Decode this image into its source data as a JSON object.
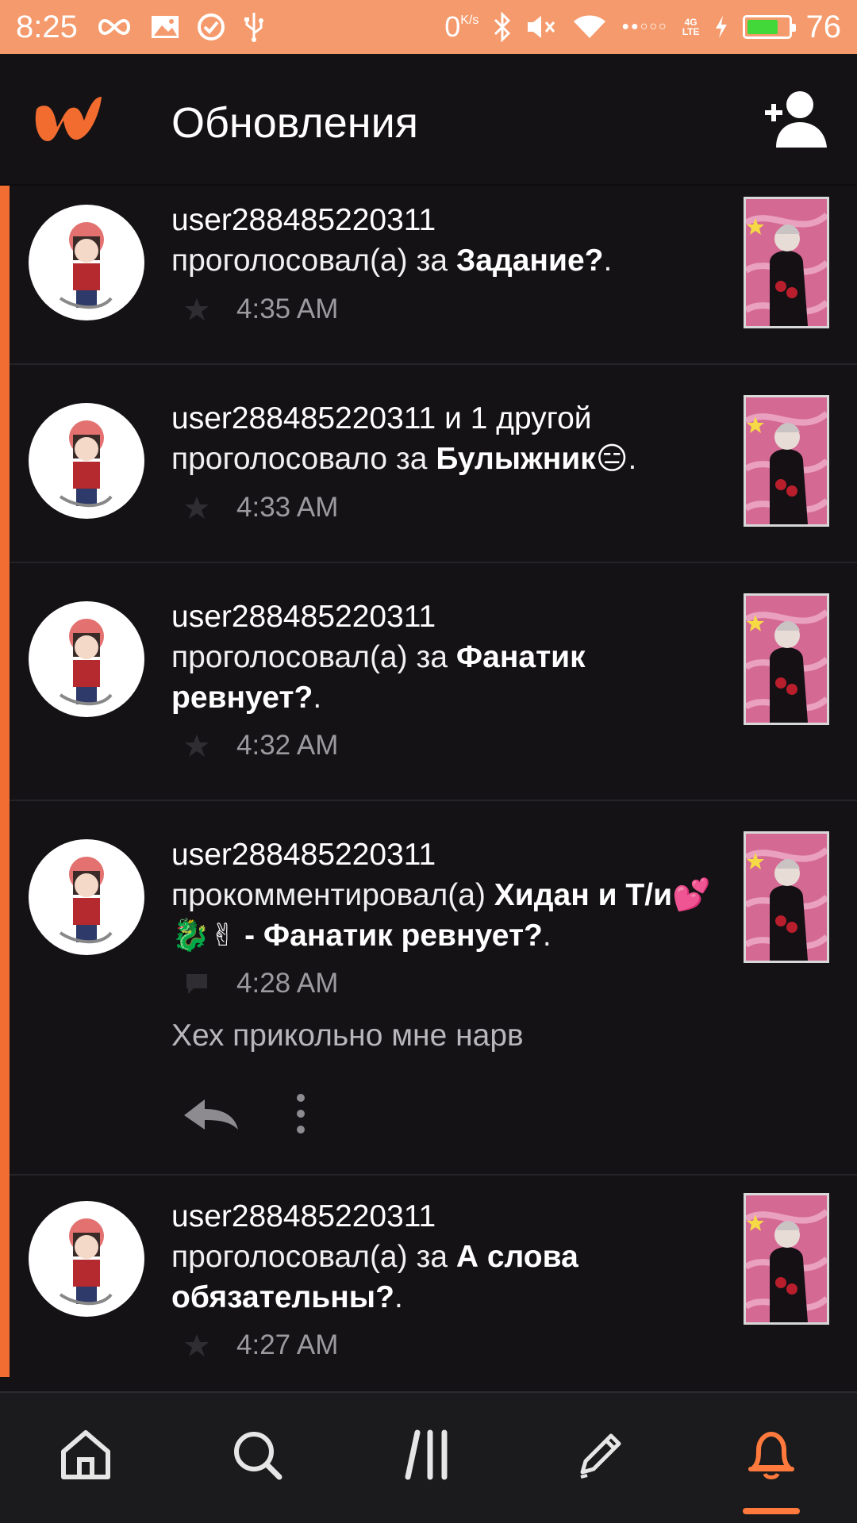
{
  "status_bar": {
    "time": "8:25",
    "net_speed": "0",
    "net_speed_unit": "K/s",
    "network_type_top": "4G",
    "network_type_bottom": "LTE",
    "battery_percent": "76",
    "battery_level": 0.76,
    "icons": [
      "infinity-icon",
      "image-icon",
      "check-circle-icon",
      "usb-icon",
      "bluetooth-icon",
      "mute-icon",
      "wifi-icon",
      "signal-icon",
      "charging-icon",
      "battery-icon"
    ]
  },
  "app_bar": {
    "title": "Обновления",
    "logo": "wattpad-logo",
    "add_user_icon": "add-user-icon",
    "accent": "#f26d32"
  },
  "feed": [
    {
      "user": "user288485220311",
      "action": "проголосовал(а) за ",
      "story": "Задание?",
      "suffix": ".",
      "meta_icon": "star-icon",
      "time": "4:35 AM"
    },
    {
      "user": "user288485220311 и 1 другой",
      "action": "проголосовало за ",
      "story": "Булыжник😑",
      "suffix": ".",
      "meta_icon": "star-icon",
      "time": "4:33 AM"
    },
    {
      "user": "user288485220311",
      "action": "проголосовал(а) за ",
      "story": "Фанатик ревнует?",
      "suffix": ".",
      "meta_icon": "star-icon",
      "time": "4:32 AM"
    },
    {
      "user": "user288485220311",
      "action": "прокомментировал(а) ",
      "story": "Хидан и Т/и💕🐉✌ - Фанатик ревнует?",
      "suffix": ".",
      "meta_icon": "comment-icon",
      "time": "4:28 AM",
      "comment": "Хех прикольно мне нарв"
    },
    {
      "user": "user288485220311",
      "action": "проголосовал(а) за ",
      "story": "А слова обязательны?",
      "suffix": ".",
      "meta_icon": "star-icon",
      "time": "4:27 AM"
    }
  ],
  "bottom_nav": {
    "items": [
      "home-icon",
      "search-icon",
      "library-icon",
      "write-icon",
      "notifications-icon"
    ],
    "active": "notifications-icon",
    "active_color": "#ff7a3c"
  }
}
